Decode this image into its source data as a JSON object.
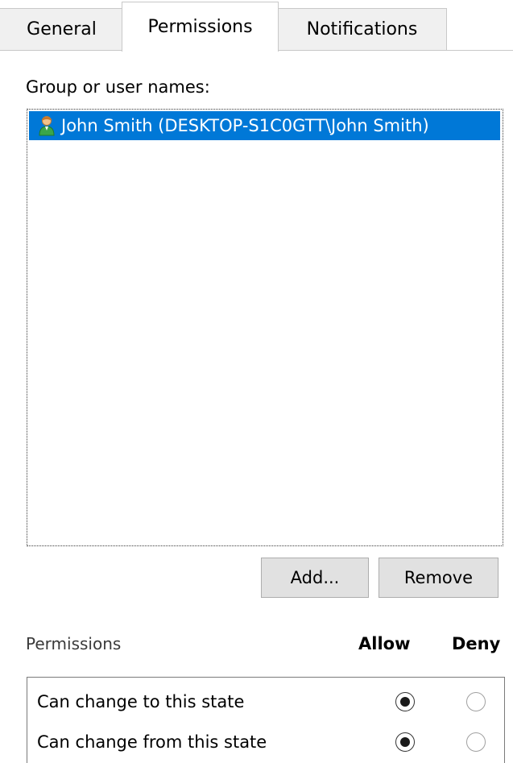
{
  "tabs": {
    "general": "General",
    "permissions": "Permissions",
    "notifications": "Notifications",
    "selected": "Permissions"
  },
  "group": {
    "label": "Group or user names:",
    "entries": [
      {
        "name": "John Smith (DESKTOP-S1C0GTT\\John Smith)",
        "icon": "user-icon",
        "selected": true
      }
    ]
  },
  "buttons": {
    "add": "Add...",
    "remove": "Remove"
  },
  "permissions": {
    "title": "Permissions",
    "allow_header": "Allow",
    "deny_header": "Deny",
    "rows": [
      {
        "label": "Can change to this state",
        "allow": true,
        "deny": false
      },
      {
        "label": "Can change from this state",
        "allow": true,
        "deny": false
      }
    ]
  },
  "colors": {
    "selection": "#0078d7",
    "button_face": "#e1e1e1",
    "tab_inactive": "#f0f0f0"
  }
}
